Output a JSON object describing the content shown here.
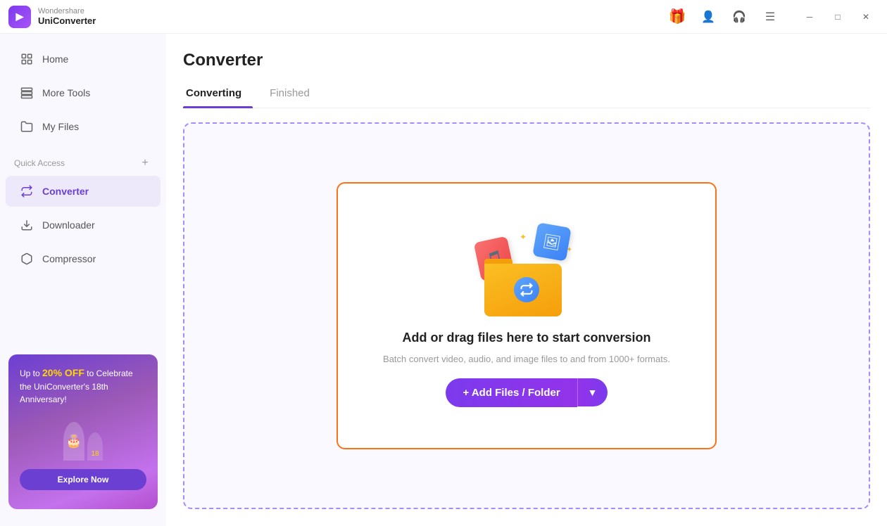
{
  "app": {
    "logo_letter": "▶",
    "brand_line1": "Wondershare",
    "brand_line2": "UniConverter"
  },
  "titlebar": {
    "icons": [
      {
        "name": "gift-icon",
        "symbol": "🎁"
      },
      {
        "name": "user-icon",
        "symbol": "👤"
      },
      {
        "name": "headset-icon",
        "symbol": "🎧"
      },
      {
        "name": "menu-icon",
        "symbol": "☰"
      }
    ],
    "window_controls": [
      {
        "name": "minimize-button",
        "symbol": "─"
      },
      {
        "name": "maximize-button",
        "symbol": "□"
      },
      {
        "name": "close-button",
        "symbol": "✕"
      }
    ]
  },
  "sidebar": {
    "nav_items": [
      {
        "id": "home",
        "label": "Home",
        "icon": "⊞",
        "active": false
      },
      {
        "id": "more-tools",
        "label": "More Tools",
        "icon": "⊟",
        "active": false
      },
      {
        "id": "my-files",
        "label": "My Files",
        "icon": "⊡",
        "active": false
      }
    ],
    "quick_access_label": "Quick Access",
    "quick_access_add_icon": "+",
    "quick_access_items": [
      {
        "id": "converter",
        "label": "Converter",
        "icon": "⟳",
        "active": true
      },
      {
        "id": "downloader",
        "label": "Downloader",
        "icon": "⬇",
        "active": false
      },
      {
        "id": "compressor",
        "label": "Compressor",
        "icon": "⊡",
        "active": false
      }
    ],
    "promo": {
      "text_prefix": "Up to ",
      "percent": "20% OFF",
      "text_suffix": " to Celebrate the UniConverter's 18th Anniversary!",
      "explore_label": "Explore Now"
    }
  },
  "content": {
    "page_title": "Converter",
    "tabs": [
      {
        "id": "converting",
        "label": "Converting",
        "active": true
      },
      {
        "id": "finished",
        "label": "Finished",
        "active": false
      }
    ],
    "drop_zone": {
      "title": "Add or drag files here to start conversion",
      "subtitle": "Batch convert video, audio, and image files to and from 1000+ formats.",
      "add_button_label": "+ Add Files / Folder",
      "add_button_arrow": "⌄"
    }
  }
}
